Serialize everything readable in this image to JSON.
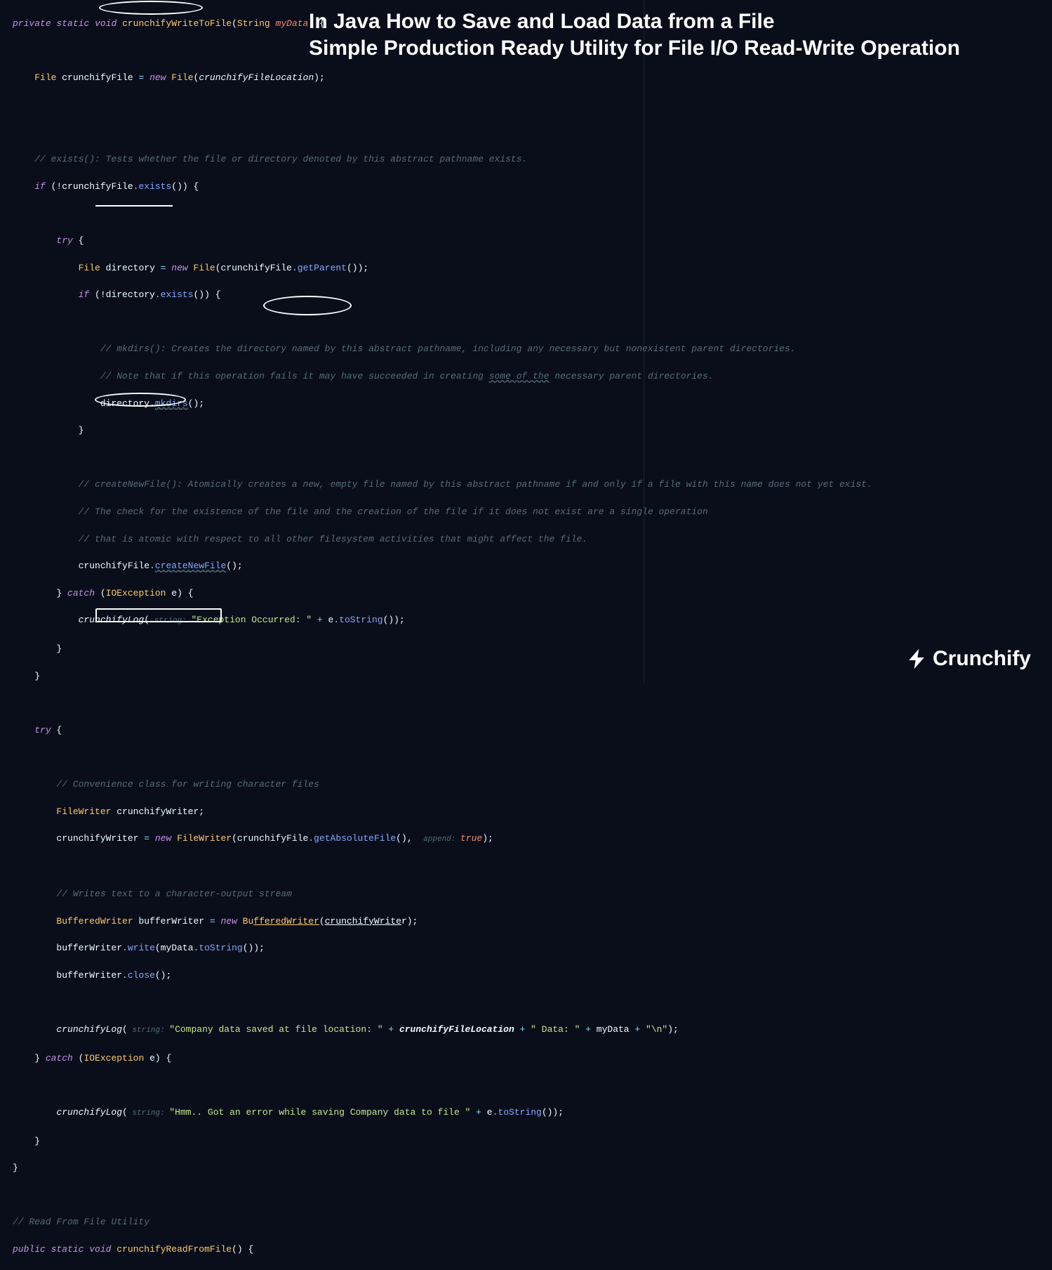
{
  "title": {
    "line1": "In Java How to Save and Load Data from a File",
    "line2": "Simple Production Ready Utility for File I/O Read-Write Operation"
  },
  "brand": "Crunchify",
  "code": {
    "l1": {
      "private": "private",
      "static": "static",
      "void": "void",
      "fn": "crunchifyWriteToFile",
      "open": "(",
      "ptype": "String",
      "pname": "myData",
      "close": ")",
      "brace": " {"
    },
    "l2": {
      "type": "File",
      "var": "crunchifyFile",
      "eq": " = ",
      "new": "new",
      "ctor": "File",
      "open": "(",
      "arg": "crunchifyFileLocation",
      "close": ");"
    },
    "l3": "// exists(): Tests whether the file or directory denoted by this abstract pathname exists.",
    "l4": {
      "if": "if",
      "open": " (!",
      "var": "crunchifyFile",
      "dot": ".",
      "m": "exists",
      "call": "()) {",
      "sp": ""
    },
    "l5": {
      "try": "try",
      "brace": " {"
    },
    "l6": {
      "type": "File",
      "var": "directory",
      "eq": " = ",
      "new": "new",
      "ctor": "File",
      "open": "(",
      "obj": "crunchifyFile",
      "dot": ".",
      "m": "getParent",
      "close": "());"
    },
    "l7": {
      "if": "if",
      "open": " (!",
      "var": "directory",
      "dot": ".",
      "m": "exists",
      "call": "()) {"
    },
    "l8": "// mkdirs(): Creates the directory named by this abstract pathname, including any necessary but nonexistent parent directories.",
    "l9a": "// Note that if this operation fails it may have succeeded in creating ",
    "l9b": "some of the",
    "l9c": " necessary parent directories.",
    "l10": {
      "var": "directory",
      "dot": ".",
      "m": "mkdirs",
      "call": "();"
    },
    "l11": "}",
    "l12": "// createNewFile(): Atomically creates a new, empty file named by this abstract pathname if and only if a file with this name does not yet exist.",
    "l13": "// The check for the existence of the file and the creation of the file if it does not exist are a single operation",
    "l14": "// that is atomic with respect to all other filesystem activities that might affect the file.",
    "l15": {
      "var": "crunchifyFile",
      "dot": ".",
      "m": "createNewFile",
      "call": "();"
    },
    "l16": {
      "close": "} ",
      "catch": "catch",
      "open": " (",
      "type": "IOException",
      "var": " e",
      "close2": ") {"
    },
    "l17": {
      "fn": "crunchifyLog",
      "open": "(",
      "hint": " string: ",
      "str": "\"Exception Occurred: \"",
      "plus": " + ",
      "e": "e",
      "dot": ".",
      "m": "toString",
      "close": "());"
    },
    "l18": "}",
    "l19": "}",
    "l20": {
      "try": "try",
      "brace": " {"
    },
    "l21": "// Convenience class for writing character files",
    "l22": {
      "type": "FileWriter",
      "var": " crunchifyWriter;"
    },
    "l23": {
      "var": "crunchifyWriter",
      "eq": " = ",
      "new": "new",
      "ctor": "FileWriter",
      "open": "(",
      "obj": "crunchifyFile",
      "dot": ".",
      "m": "getAbsoluteFile",
      "mid": "(),  ",
      "hint": "append: ",
      "bool": "true",
      "close": ");"
    },
    "l24": "// Writes text to a character-output stream",
    "l25": {
      "type": "BufferedWriter",
      "var": " bufferWriter",
      "eq": " = ",
      "new": "new",
      "ctor1": " Bu",
      "ctor2": "fferedWriter",
      "open": "(",
      "arg": "crunchifyWrite",
      "arg2": "r",
      "close": ");"
    },
    "l26": {
      "var": "bufferWriter",
      "dot": ".",
      "m": "write",
      "open": "(",
      "arg": "myData",
      "dot2": ".",
      "m2": "toString",
      "close": "());"
    },
    "l27": {
      "var": "bufferWriter",
      "dot": ".",
      "m": "close",
      "call": "();"
    },
    "l28": {
      "fn": "crunchifyLog",
      "open": "(",
      "hint": " string: ",
      "s1": "\"Company data saved at file location: \"",
      "p": " + ",
      "v1": "crunchifyFileLocation",
      "p2": " + ",
      "s2": "\" Data: \"",
      "p3": " + ",
      "v2": "myData",
      "p4": " + ",
      "s3": "\"\\n\"",
      "close": ");"
    },
    "l29": {
      "close": "} ",
      "catch": "catch",
      "open": " (",
      "type": "IOException",
      "var": " e",
      "close2": ") {"
    },
    "l30": {
      "fn": "crunchifyLog",
      "open": "(",
      "hint": " string: ",
      "str": "\"Hmm.. Got an error while saving Company data to file \"",
      "plus": " + ",
      "e": "e",
      "dot": ".",
      "m": "toString",
      "close": "());"
    },
    "l31": "}",
    "l32": "}",
    "l33": "// Read From File Utility",
    "l34": {
      "public": "public",
      "static": "static",
      "void": "void",
      "fn": "crunchifyReadFromFile",
      "open": "() {",
      "sp": ""
    }
  }
}
